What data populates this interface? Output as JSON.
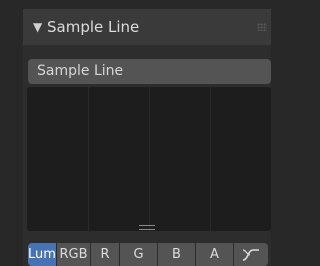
{
  "panel": {
    "title": "Sample Line",
    "collapse_icon": "disclosure-triangle-down-icon",
    "grip_icon": "drag-grip-icon"
  },
  "sample_field": {
    "label": "Sample Line"
  },
  "channels": {
    "lum": "Lum",
    "rgb": "RGB",
    "r": "R",
    "g": "G",
    "b": "B",
    "a": "A",
    "selected": "Lum",
    "log_icon": "curve-icon"
  },
  "colors": {
    "accent": "#4772b3",
    "button": "#545454",
    "graph_bg": "#1d1d1d"
  }
}
